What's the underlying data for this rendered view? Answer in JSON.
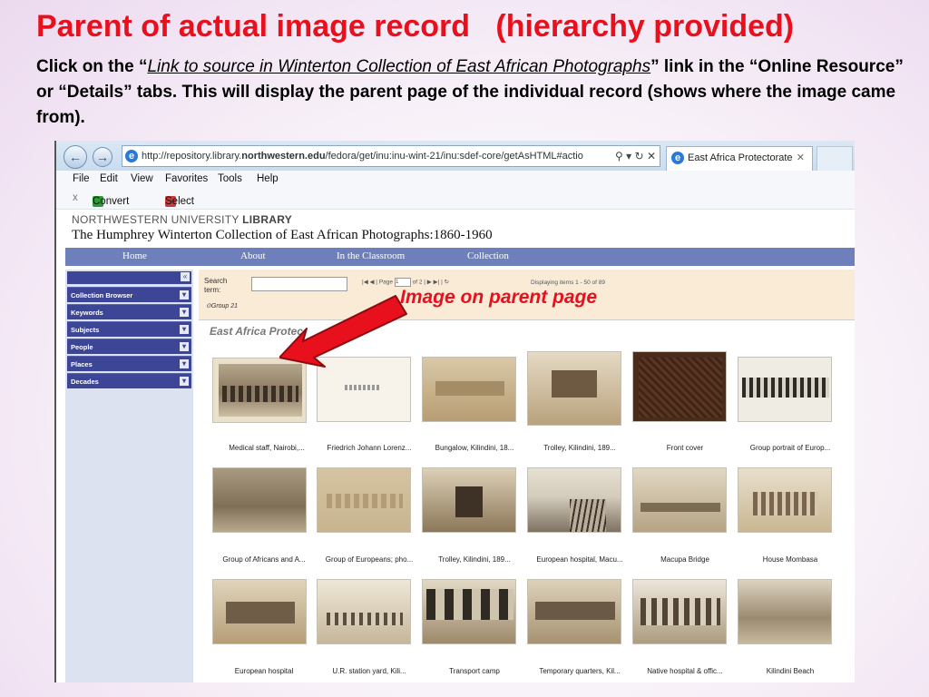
{
  "slide": {
    "title": "Parent of actual image record   (hierarchy provided)",
    "instr_pre": "Click on the “",
    "instr_link": "Link to source in Winterton Collection of East African Photographs",
    "instr_post": "” link in the “Online Resource” or “Details” tabs.  This will display the parent page of the individual record (shows where the image came from).",
    "annotation": "Image on parent page"
  },
  "browser": {
    "url_pre": "http://repository.library.",
    "url_bold": "northwestern.edu",
    "url_post": "/fedora/get/inu:inu-wint-21/inu:sdef-core/getAsHTML#actio",
    "tab_title": "East Africa Protectorate",
    "menu": [
      "File",
      "Edit",
      "View",
      "Favorites",
      "Tools",
      "Help"
    ],
    "cmd_convert": "Convert",
    "cmd_select": "Select"
  },
  "library": {
    "header_light": "NORTHWESTERN UNIVERSITY ",
    "header_bold": "LIBRARY",
    "collection_title": "The Humphrey Winterton Collection of East African Photographs:1860-1960",
    "nav": [
      "Home",
      "About",
      "In the Classroom",
      "Collection"
    ]
  },
  "sidebar": {
    "items": [
      "Collection Browser",
      "Keywords",
      "Subjects",
      "People",
      "Places",
      "Decades"
    ]
  },
  "search": {
    "label": "Search term:",
    "group": "Group 21",
    "page_label": "Page",
    "page_value": "1",
    "page_of": "of 2",
    "displaying": "Displaying items 1 - 50 of 89"
  },
  "gallery": {
    "section_title": "East Africa Protec",
    "captions": [
      "Medical staff, Nairobi,...",
      "Friedrich Johann Lorenz...",
      "Bungalow, Kilindini, 18...",
      "Trolley, Kilindini, 189...",
      "Front cover",
      "Group portrait of Europ...",
      "Group of Africans and A...",
      "Group of Europeans; pho...",
      "Trolley, Kilindini, 189...",
      "European hospital, Macu...",
      "Macupa Bridge",
      "House Mombasa",
      "European hospital",
      "U.R. station yard, Kili...",
      "Transport camp",
      "Temporary quarters, Kil...",
      "Native hospital & offic...",
      "Kilindini Beach"
    ]
  }
}
